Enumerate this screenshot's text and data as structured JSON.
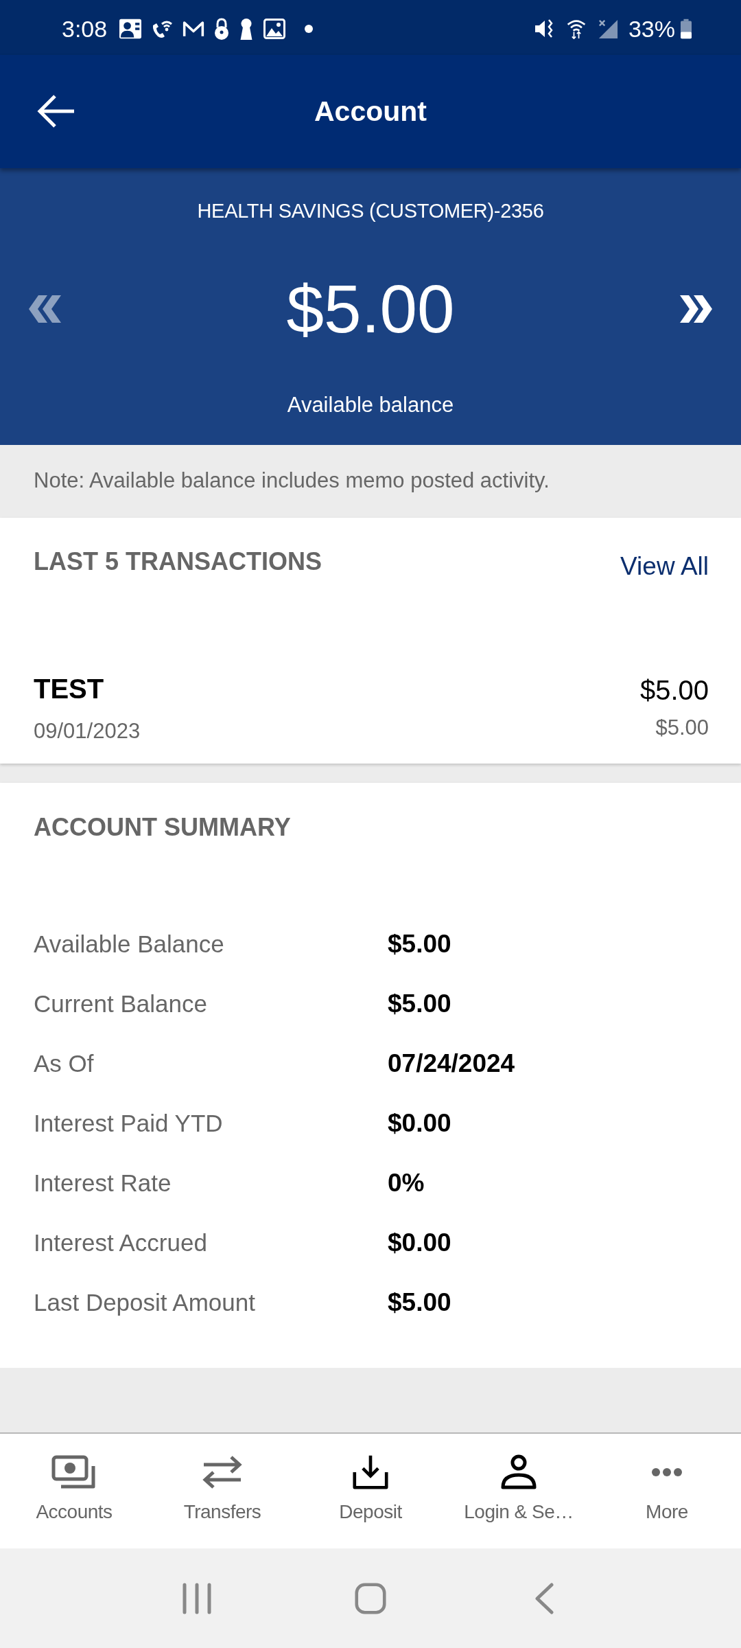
{
  "status_bar": {
    "time": "3:08",
    "battery": "33%"
  },
  "app_bar": {
    "title": "Account"
  },
  "account": {
    "name": "HEALTH SAVINGS (CUSTOMER)-2356",
    "balance": "$5.00",
    "balance_label": "Available balance",
    "previous": {
      "disabled": true
    },
    "next": {
      "disabled": false
    }
  },
  "note": "Note: Available balance includes memo posted activity.",
  "transactions": {
    "title": "LAST 5 TRANSACTIONS",
    "view_all": "View All",
    "items": [
      {
        "description": "TEST",
        "date": "09/01/2023",
        "amount": "$5.00",
        "balance": "$5.00"
      }
    ]
  },
  "summary": {
    "title": "ACCOUNT SUMMARY",
    "rows": [
      {
        "label": "Available Balance",
        "value": "$5.00"
      },
      {
        "label": "Current Balance",
        "value": "$5.00"
      },
      {
        "label": "As Of",
        "value": "07/24/2024"
      },
      {
        "label": "Interest Paid YTD",
        "value": "$0.00"
      },
      {
        "label": "Interest Rate",
        "value": "0%"
      },
      {
        "label": "Interest Accrued",
        "value": "$0.00"
      },
      {
        "label": "Last Deposit Amount",
        "value": "$5.00"
      }
    ]
  },
  "bottom_nav": [
    {
      "label": "Accounts",
      "kind": "accounts"
    },
    {
      "label": "Transfers",
      "kind": "transfers"
    },
    {
      "label": "Deposit",
      "kind": "deposit"
    },
    {
      "label": "Login & Se…",
      "kind": "login"
    },
    {
      "label": "More",
      "kind": "more"
    }
  ]
}
